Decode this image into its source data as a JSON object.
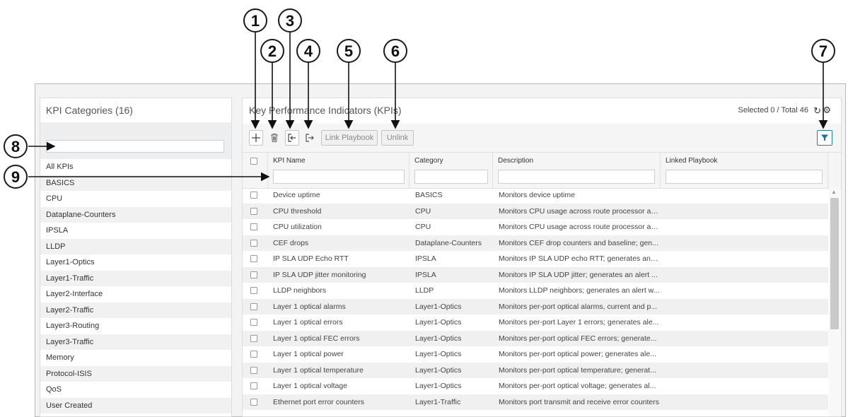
{
  "callouts": [
    "1",
    "2",
    "3",
    "4",
    "5",
    "6",
    "7",
    "8",
    "9"
  ],
  "left_panel": {
    "title": "KPI Categories (16)",
    "search_value": "",
    "categories": [
      "All KPIs",
      "BASICS",
      "CPU",
      "Dataplane-Counters",
      "IPSLA",
      "LLDP",
      "Layer1-Optics",
      "Layer1-Traffic",
      "Layer2-Interface",
      "Layer2-Traffic",
      "Layer3-Routing",
      "Layer3-Traffic",
      "Memory",
      "Protocol-ISIS",
      "QoS",
      "User Created"
    ]
  },
  "right_panel": {
    "title": "Key Performance Indicators (KPIs)",
    "counts": "Selected 0 / Total 46",
    "refresh_icon": "↻",
    "gear_icon": "⚙",
    "toolbar": {
      "add_icon": "plus-icon",
      "delete_icon": "trash-icon",
      "import_icon": "import-icon",
      "export_icon": "export-icon",
      "link_playbook_label": "Link Playbook",
      "unlink_label": "Unlink",
      "filter_icon": "filter-icon"
    }
  },
  "table": {
    "columns": [
      "KPI Name",
      "Category",
      "Description",
      "Linked Playbook"
    ],
    "rows": [
      {
        "name": "Device uptime",
        "category": "BASICS",
        "description": "Monitors device uptime",
        "playbook": ""
      },
      {
        "name": "CPU threshold",
        "category": "CPU",
        "description": "Monitors CPU usage across route processor an...",
        "playbook": ""
      },
      {
        "name": "CPU utilization",
        "category": "CPU",
        "description": "Monitors CPU usage across route processor an...",
        "playbook": ""
      },
      {
        "name": "CEF drops",
        "category": "Dataplane-Counters",
        "description": "Monitors CEF drop counters and baseline; gen...",
        "playbook": ""
      },
      {
        "name": "IP SLA UDP Echo RTT",
        "category": "IPSLA",
        "description": "Monitors IP SLA UDP echo RTT; generates an a...",
        "playbook": ""
      },
      {
        "name": "IP SLA UDP jitter monitoring",
        "category": "IPSLA",
        "description": "Monitors IP SLA UDP jitter; generates an alert ...",
        "playbook": ""
      },
      {
        "name": "LLDP neighbors",
        "category": "LLDP",
        "description": "Monitors LLDP neighbors; generates an alert w...",
        "playbook": ""
      },
      {
        "name": "Layer 1 optical alarms",
        "category": "Layer1-Optics",
        "description": "Monitors per-port optical alarms, current and p...",
        "playbook": ""
      },
      {
        "name": "Layer 1 optical errors",
        "category": "Layer1-Optics",
        "description": "Monitors per-port Layer 1 errors; generates ale...",
        "playbook": ""
      },
      {
        "name": "Layer 1 optical FEC errors",
        "category": "Layer1-Optics",
        "description": "Monitors per-port optical FEC errors; generate...",
        "playbook": ""
      },
      {
        "name": "Layer 1 optical power",
        "category": "Layer1-Optics",
        "description": "Monitors per-port optical power; generates ale...",
        "playbook": ""
      },
      {
        "name": "Layer 1 optical temperature",
        "category": "Layer1-Optics",
        "description": "Monitors per-port optical temperature; generat...",
        "playbook": ""
      },
      {
        "name": "Layer 1 optical voltage",
        "category": "Layer1-Optics",
        "description": "Monitors per-port optical voltage; generates al...",
        "playbook": ""
      },
      {
        "name": "Ethernet port error counters",
        "category": "Layer1-Traffic",
        "description": "Monitors port transmit and receive error counters",
        "playbook": ""
      }
    ]
  },
  "colors": {
    "accent": "#1c7fbc",
    "row_alt": "#f0f0f0",
    "callout_border": "#1a1a1a"
  }
}
